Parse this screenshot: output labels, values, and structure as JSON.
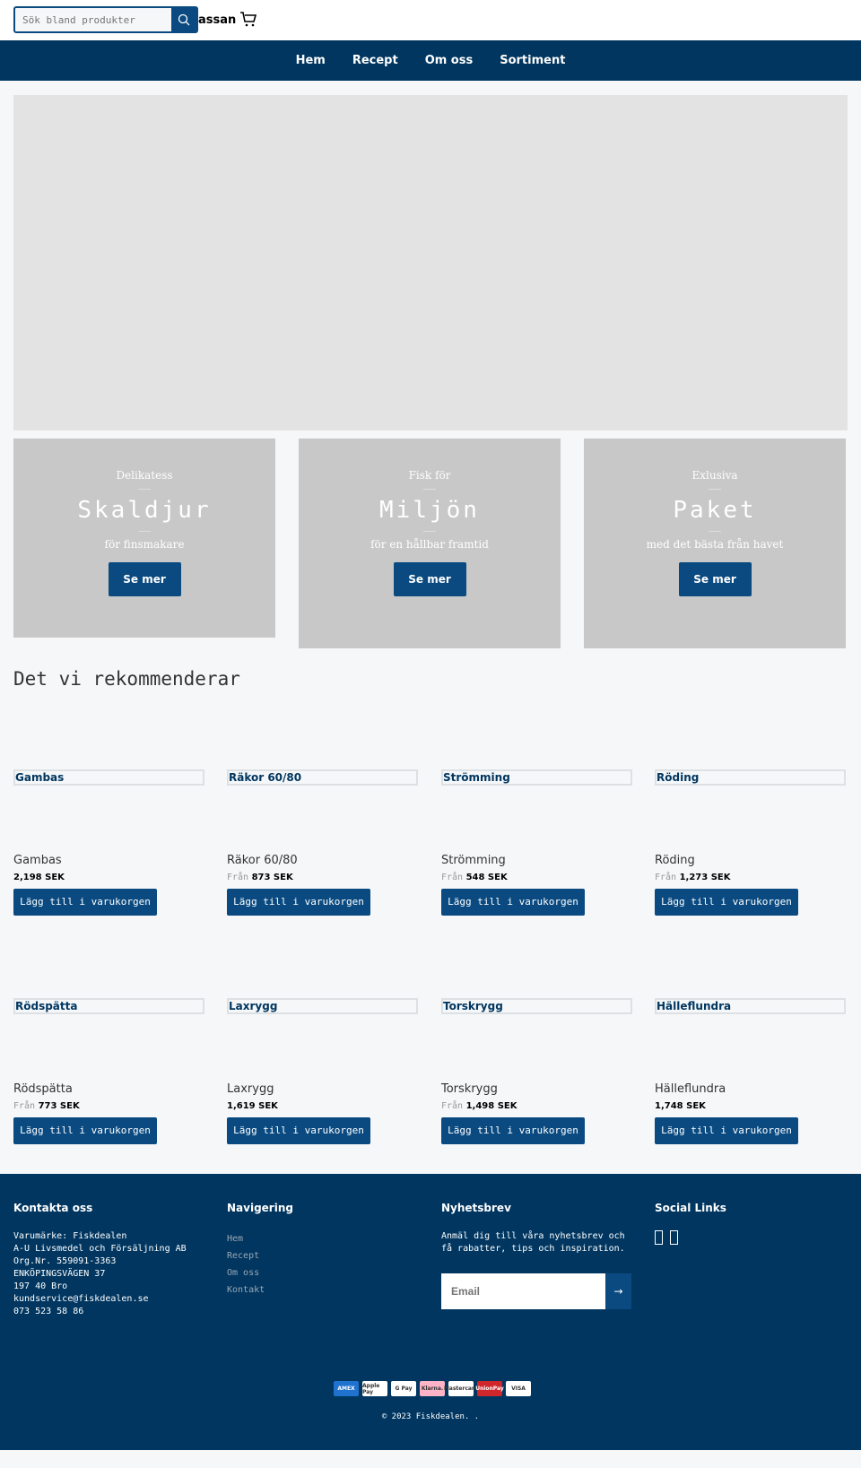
{
  "header": {
    "search_placeholder": "Sök bland produkter",
    "logo_partial": "assan"
  },
  "nav": [
    "Hem",
    "Recept",
    "Om oss",
    "Sortiment"
  ],
  "promos": [
    {
      "pre": "Delikatess",
      "title": "Skaldjur",
      "sub": "för finsmakare",
      "button": "Se mer"
    },
    {
      "pre": "Fisk för",
      "title": "Miljön",
      "sub": "för en hållbar framtid",
      "button": "Se mer"
    },
    {
      "pre": "Exlusiva",
      "title": "Paket",
      "sub": "med det bästa från havet",
      "button": "Se mer"
    }
  ],
  "section_title": "Det vi rekommenderar",
  "from_label": "Från",
  "add_label": "Lägg till i varukorgen",
  "products": [
    {
      "name": "Gambas",
      "price": "2,198 SEK",
      "from": false
    },
    {
      "name": "Räkor 60/80",
      "price": "873 SEK",
      "from": true
    },
    {
      "name": "Strömming",
      "price": "548 SEK",
      "from": true
    },
    {
      "name": "Röding",
      "price": "1,273 SEK",
      "from": true
    },
    {
      "name": "Rödspätta",
      "price": "773 SEK",
      "from": true
    },
    {
      "name": "Laxrygg",
      "price": "1,619 SEK",
      "from": false
    },
    {
      "name": "Torskrygg",
      "price": "1,498 SEK",
      "from": true
    },
    {
      "name": "Hälleflundra",
      "price": "1,748 SEK",
      "from": false
    }
  ],
  "footer": {
    "contact_title": "Kontakta oss",
    "contact_lines": [
      "Varumärke: Fiskdealen",
      "A-U Livsmedel och Försäljning AB",
      "Org.Nr. 559091-3363",
      "ENKÖPINGSVÄGEN 37",
      "197 40 Bro",
      "kundservice@fiskdealen.se",
      "073 523 58 86"
    ],
    "nav_title": "Navigering",
    "nav_links": [
      "Hem",
      "Recept",
      "Om oss",
      "Kontakt"
    ],
    "newsletter_title": "Nyhetsbrev",
    "newsletter_text": "Anmäl dig till våra nyhetsbrev och få rabatter, tips och inspiration.",
    "email_placeholder": "Email",
    "social_title": "Social Links",
    "payments": [
      "AMEX",
      "Apple Pay",
      "G Pay",
      "Klarna.",
      "Mastercard",
      "UnionPay",
      "VISA"
    ],
    "copyright": "© 2023 Fiskdealen. ."
  },
  "colors": {
    "primary": "#003660",
    "button": "#0a4a80"
  }
}
